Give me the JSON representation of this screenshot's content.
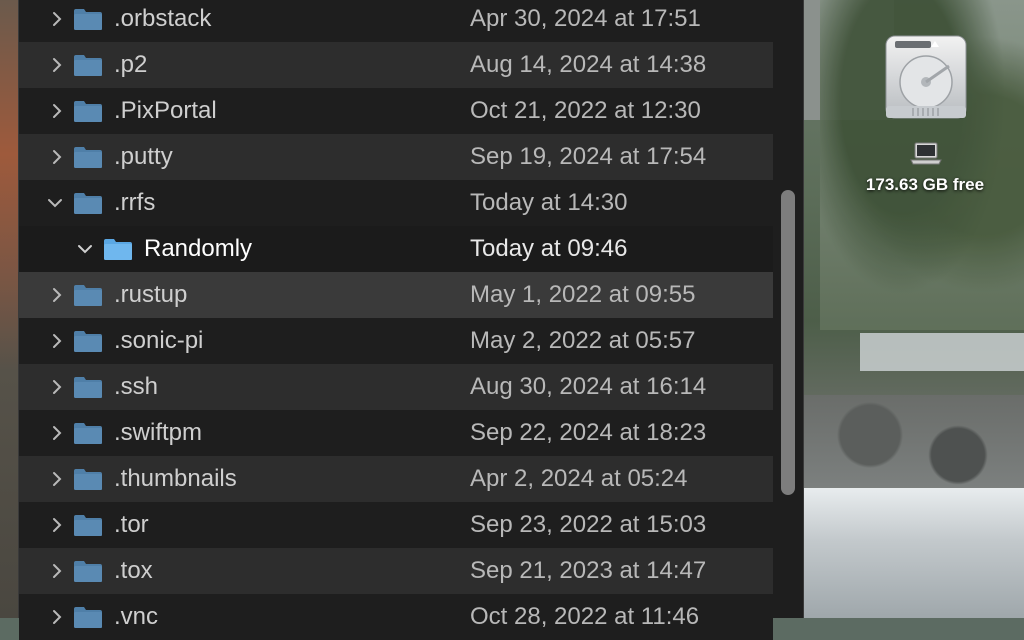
{
  "desktop": {
    "drive_label": "173.63 GB free"
  },
  "rows": [
    {
      "name": ".orbstack",
      "date": "Apr 30, 2024 at 17:51",
      "expanded": false
    },
    {
      "name": ".p2",
      "date": "Aug 14, 2024 at 14:38",
      "expanded": false
    },
    {
      "name": ".PixPortal",
      "date": "Oct 21, 2022 at 12:30",
      "expanded": false
    },
    {
      "name": ".putty",
      "date": "Sep 19, 2024 at 17:54",
      "expanded": false
    },
    {
      "name": ".rrfs",
      "date": "Today at 14:30",
      "expanded": true
    },
    {
      "name": "Randomly",
      "date": "Today at 09:46",
      "expanded": false
    },
    {
      "name": ".rustup",
      "date": "May 1, 2022 at 09:55",
      "expanded": false
    },
    {
      "name": ".sonic-pi",
      "date": "May 2, 2022 at 05:57",
      "expanded": false
    },
    {
      "name": ".ssh",
      "date": "Aug 30, 2024 at 16:14",
      "expanded": false
    },
    {
      "name": ".swiftpm",
      "date": "Sep 22, 2024 at 18:23",
      "expanded": false
    },
    {
      "name": ".thumbnails",
      "date": "Apr 2, 2024 at 05:24",
      "expanded": false
    },
    {
      "name": ".tor",
      "date": "Sep 23, 2022 at 15:03",
      "expanded": false
    },
    {
      "name": ".tox",
      "date": "Sep 21, 2023 at 14:47",
      "expanded": false
    },
    {
      "name": ".vnc",
      "date": "Oct 28, 2022 at 11:46",
      "expanded": false
    }
  ],
  "colors": {
    "folder_dark": "#4f7fa8",
    "folder_light": "#6fb7ee",
    "row_alt": "#2d2d2d",
    "row_base": "#1e1e1e"
  },
  "icons": {
    "collapsed": "chevron-right-icon",
    "expanded": "chevron-down-icon",
    "folder": "folder-icon",
    "drive": "hard-drive-icon",
    "laptop": "laptop-icon"
  }
}
